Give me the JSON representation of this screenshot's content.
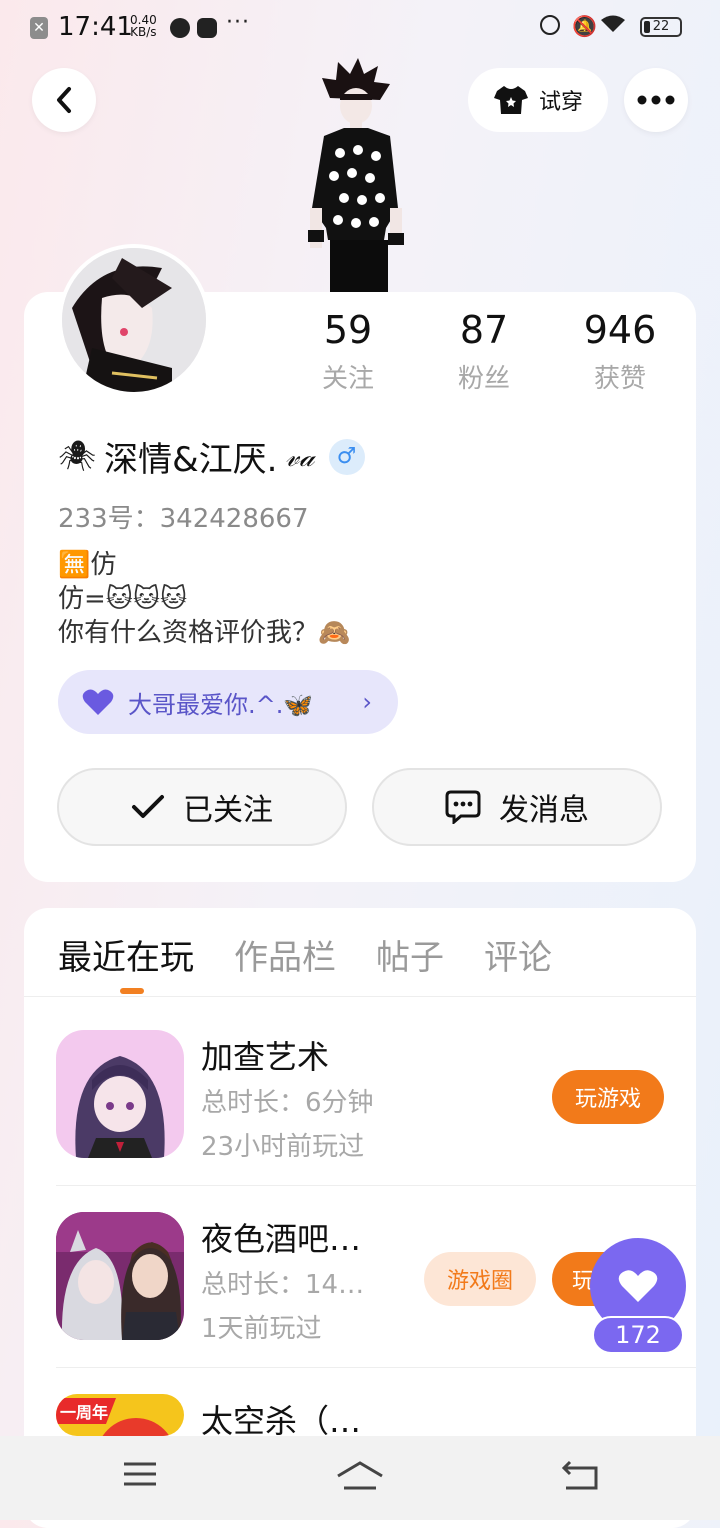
{
  "status_bar": {
    "time": "17:41",
    "net_speed_value": "0.40",
    "net_speed_unit": "KB/s",
    "battery": "22"
  },
  "header": {
    "try_on_label": "试穿"
  },
  "profile": {
    "stats": [
      {
        "value": "59",
        "label": "关注"
      },
      {
        "value": "87",
        "label": "粉丝"
      },
      {
        "value": "946",
        "label": "获赞"
      }
    ],
    "name_prefix": "🕷",
    "name": "深情&江厌.",
    "name_suffix": "𝓋𝒶",
    "gender_symbol": "♂",
    "id_line": "233号：342428667",
    "bio_lines": [
      "🈚仿",
      "仿=🐱🐱🐱",
      "你有什么资格评价我？🙈"
    ],
    "badge_text": "大哥最爱你.^.🦋",
    "follow_label": "已关注",
    "message_label": "发消息"
  },
  "tabs": [
    {
      "label": "最近在玩",
      "active": true
    },
    {
      "label": "作品栏",
      "active": false
    },
    {
      "label": "帖子",
      "active": false
    },
    {
      "label": "评论",
      "active": false
    }
  ],
  "games": [
    {
      "title": "加查艺术",
      "duration": "总时长：6分钟",
      "last_played": "23小时前玩过",
      "play_label": "玩游戏"
    },
    {
      "title": "夜色酒吧…",
      "duration": "总时长：14…",
      "last_played": "1天前玩过",
      "circle_label": "游戏圈",
      "play_label": "玩"
    },
    {
      "title": "太空杀（…",
      "ribbon": "一周年"
    }
  ],
  "like_count": "172",
  "colors": {
    "accent_orange": "#f27a1a",
    "accent_purple": "#7b68f0",
    "badge_bg": "#e7e6fb"
  }
}
